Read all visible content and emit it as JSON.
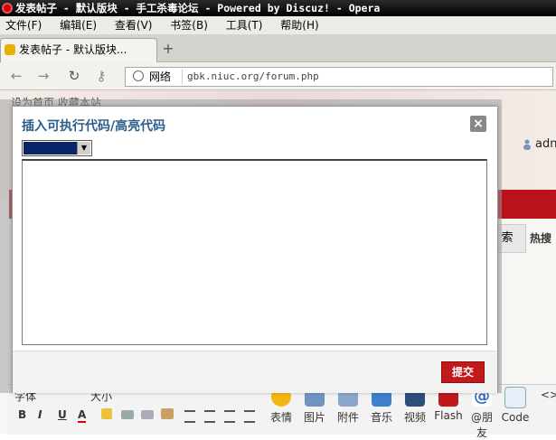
{
  "window": {
    "title": "发表帖子 - 默认版块 - 手工杀毒论坛 - Powered by Discuz! - Opera"
  },
  "menu": [
    "文件(F)",
    "编辑(E)",
    "查看(V)",
    "书签(B)",
    "工具(T)",
    "帮助(H)"
  ],
  "tab": {
    "label": "发表帖子 - 默认版块...",
    "close": "×",
    "new": "+"
  },
  "address": {
    "zone": "网络",
    "url": "gbk.niuc.org/forum.php"
  },
  "page": {
    "toplinks": "设为首页  收藏本站",
    "user": "adn",
    "search_button": "索",
    "hot_search": "热搜"
  },
  "dialog": {
    "title": "插入可执行代码/高亮代码",
    "close": "×",
    "code_value": "",
    "submit": "提交"
  },
  "editor_toolbar": {
    "format_row1": [
      "字体",
      "大小"
    ],
    "format_row2": [
      "B",
      "I",
      "U",
      "A"
    ],
    "items": [
      "表情",
      "图片",
      "附件",
      "音乐",
      "视频",
      "Flash",
      "@朋友",
      "Code"
    ]
  },
  "colors": {
    "accent": "#2b5e8b",
    "submit_bg": "#c21a1a",
    "brand_red": "#b9121b"
  }
}
